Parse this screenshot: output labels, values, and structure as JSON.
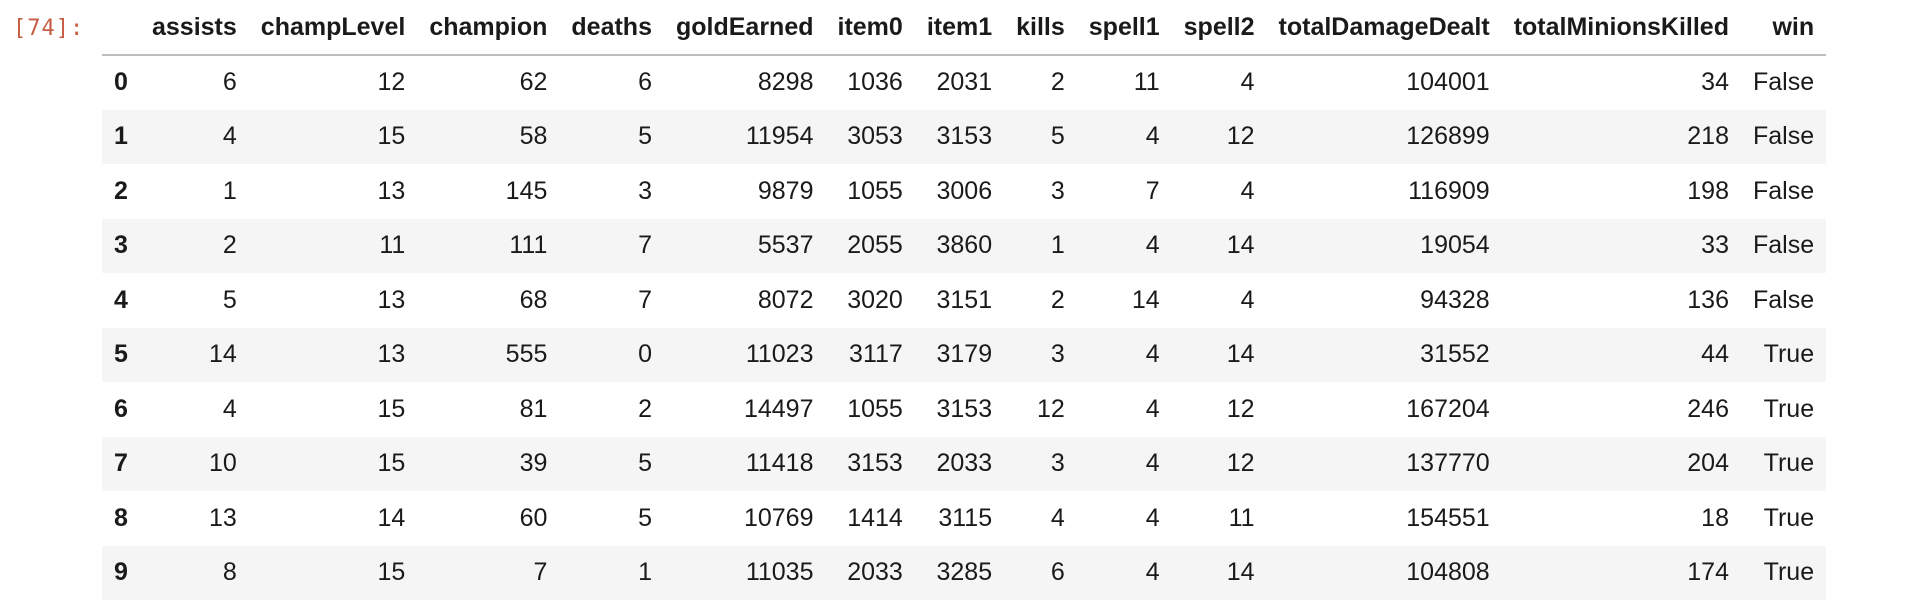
{
  "cell": {
    "prompt": "[74]:"
  },
  "table": {
    "columns": [
      "assists",
      "champLevel",
      "champion",
      "deaths",
      "goldEarned",
      "item0",
      "item1",
      "kills",
      "spell1",
      "spell2",
      "totalDamageDealt",
      "totalMinionsKilled",
      "win"
    ],
    "rows": [
      {
        "index": "0",
        "cells": [
          "6",
          "12",
          "62",
          "6",
          "8298",
          "1036",
          "2031",
          "2",
          "11",
          "4",
          "104001",
          "34",
          "False"
        ]
      },
      {
        "index": "1",
        "cells": [
          "4",
          "15",
          "58",
          "5",
          "11954",
          "3053",
          "3153",
          "5",
          "4",
          "12",
          "126899",
          "218",
          "False"
        ]
      },
      {
        "index": "2",
        "cells": [
          "1",
          "13",
          "145",
          "3",
          "9879",
          "1055",
          "3006",
          "3",
          "7",
          "4",
          "116909",
          "198",
          "False"
        ]
      },
      {
        "index": "3",
        "cells": [
          "2",
          "11",
          "111",
          "7",
          "5537",
          "2055",
          "3860",
          "1",
          "4",
          "14",
          "19054",
          "33",
          "False"
        ]
      },
      {
        "index": "4",
        "cells": [
          "5",
          "13",
          "68",
          "7",
          "8072",
          "3020",
          "3151",
          "2",
          "14",
          "4",
          "94328",
          "136",
          "False"
        ]
      },
      {
        "index": "5",
        "cells": [
          "14",
          "13",
          "555",
          "0",
          "11023",
          "3117",
          "3179",
          "3",
          "4",
          "14",
          "31552",
          "44",
          "True"
        ]
      },
      {
        "index": "6",
        "cells": [
          "4",
          "15",
          "81",
          "2",
          "14497",
          "1055",
          "3153",
          "12",
          "4",
          "12",
          "167204",
          "246",
          "True"
        ]
      },
      {
        "index": "7",
        "cells": [
          "10",
          "15",
          "39",
          "5",
          "11418",
          "3153",
          "2033",
          "3",
          "4",
          "12",
          "137770",
          "204",
          "True"
        ]
      },
      {
        "index": "8",
        "cells": [
          "13",
          "14",
          "60",
          "5",
          "10769",
          "1414",
          "3115",
          "4",
          "4",
          "11",
          "154551",
          "18",
          "True"
        ]
      },
      {
        "index": "9",
        "cells": [
          "8",
          "15",
          "7",
          "1",
          "11035",
          "2033",
          "3285",
          "6",
          "4",
          "14",
          "104808",
          "174",
          "True"
        ]
      }
    ]
  }
}
